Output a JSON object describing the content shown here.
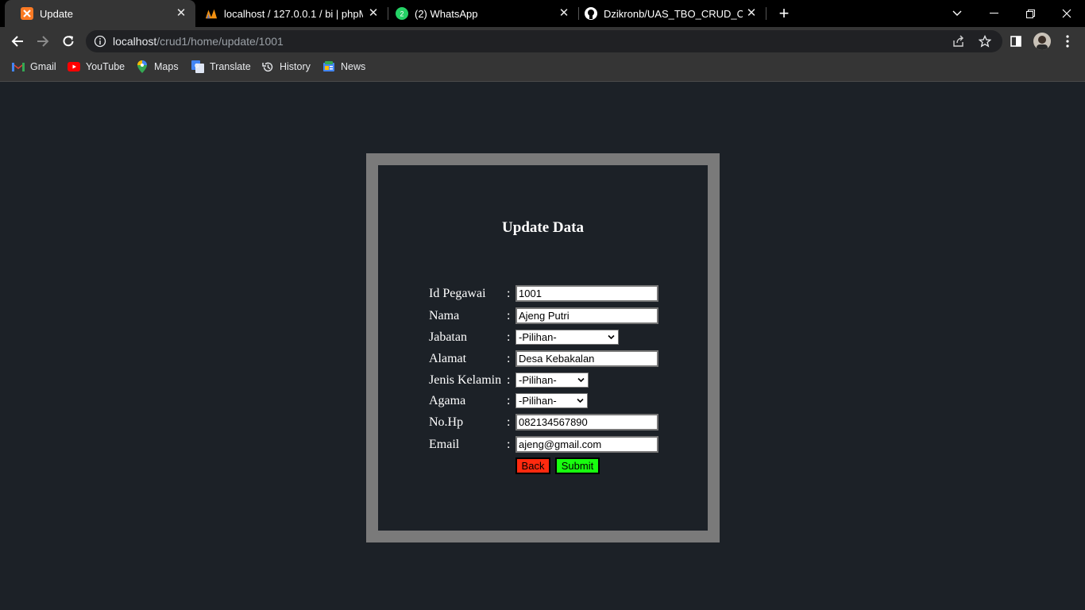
{
  "browser": {
    "tabs": [
      {
        "title": "Update",
        "icon": "xampp-icon",
        "active": true
      },
      {
        "title": "localhost / 127.0.0.1 / bi | phpMy",
        "icon": "phpmyadmin-icon",
        "active": false
      },
      {
        "title": "(2) WhatsApp",
        "icon": "whatsapp-icon",
        "active": false,
        "badge": "2"
      },
      {
        "title": "Dzikronb/UAS_TBO_CRUD_CODE",
        "icon": "github-icon",
        "active": false
      }
    ],
    "address": {
      "host": "localhost",
      "path": "/crud1/home/update/1001"
    },
    "bookmarks": [
      {
        "label": "Gmail",
        "icon": "gmail-icon"
      },
      {
        "label": "YouTube",
        "icon": "youtube-icon"
      },
      {
        "label": "Maps",
        "icon": "maps-icon"
      },
      {
        "label": "Translate",
        "icon": "translate-icon"
      },
      {
        "label": "History",
        "icon": "history-icon"
      },
      {
        "label": "News",
        "icon": "news-icon"
      }
    ]
  },
  "form": {
    "title": "Update Data",
    "colon": ":",
    "fields": {
      "id_pegawai": {
        "label": "Id Pegawai",
        "value": "1001"
      },
      "nama": {
        "label": "Nama",
        "value": "Ajeng Putri"
      },
      "jabatan": {
        "label": "Jabatan",
        "selected": "-Pilihan-"
      },
      "alamat": {
        "label": "Alamat",
        "value": "Desa Kebakalan"
      },
      "jenis_kelamin": {
        "label": "Jenis Kelamin",
        "selected": "-Pilihan-"
      },
      "agama": {
        "label": "Agama",
        "selected": "-Pilihan-"
      },
      "no_hp": {
        "label": "No.Hp",
        "value": "082134567890"
      },
      "email": {
        "label": "Email",
        "value": "ajeng@gmail.com"
      }
    },
    "back_label": "Back",
    "submit_label": "Submit"
  },
  "colors": {
    "page_bg": "#1c2127",
    "frame": "#7a7a7a",
    "back_button": "#ff2a0f",
    "submit_button": "#18ff0f"
  }
}
